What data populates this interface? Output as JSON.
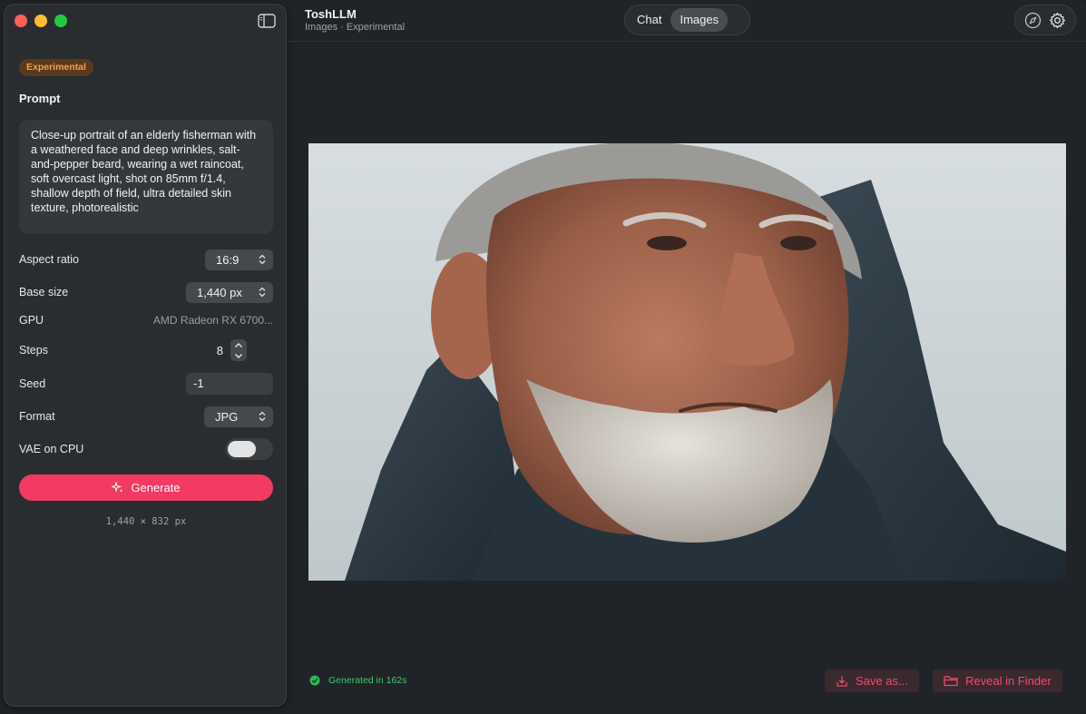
{
  "window": {
    "app_title": "ToshLLM",
    "subtitle": "Images · Experimental"
  },
  "header": {
    "tabs": [
      {
        "label": "Chat",
        "active": false
      },
      {
        "label": "Images",
        "active": true
      }
    ],
    "icons": [
      "compass-icon",
      "gear-icon"
    ]
  },
  "sidebar": {
    "badge": "Experimental",
    "prompt_label": "Prompt",
    "prompt_text": "Close-up portrait of an elderly fisherman with a weathered face and deep wrinkles, salt-and-pepper beard, wearing a wet raincoat, soft overcast light, shot on 85mm f/1.4, shallow depth of field, ultra detailed skin texture, photorealistic",
    "settings": {
      "aspect_ratio": {
        "label": "Aspect ratio",
        "value": "16:9"
      },
      "base_size": {
        "label": "Base size",
        "value": "1,440 px"
      },
      "gpu": {
        "label": "GPU",
        "value": "AMD Radeon RX 6700..."
      },
      "steps": {
        "label": "Steps",
        "value": "8"
      },
      "seed": {
        "label": "Seed",
        "value": "-1"
      },
      "format": {
        "label": "Format",
        "value": "JPG"
      },
      "vae_on_cpu": {
        "label": "VAE on CPU",
        "on": false
      }
    },
    "generate_label": "Generate",
    "dimensions": "1,440 × 832 px"
  },
  "main": {
    "image_alt": "Close-up portrait of an elderly fisherman",
    "status": "Generated in 162s",
    "save_label": "Save as...",
    "reveal_label": "Reveal in Finder"
  },
  "colors": {
    "accent": "#f23a62",
    "badge_text": "#f0a050",
    "status_green": "#3fc86a"
  }
}
